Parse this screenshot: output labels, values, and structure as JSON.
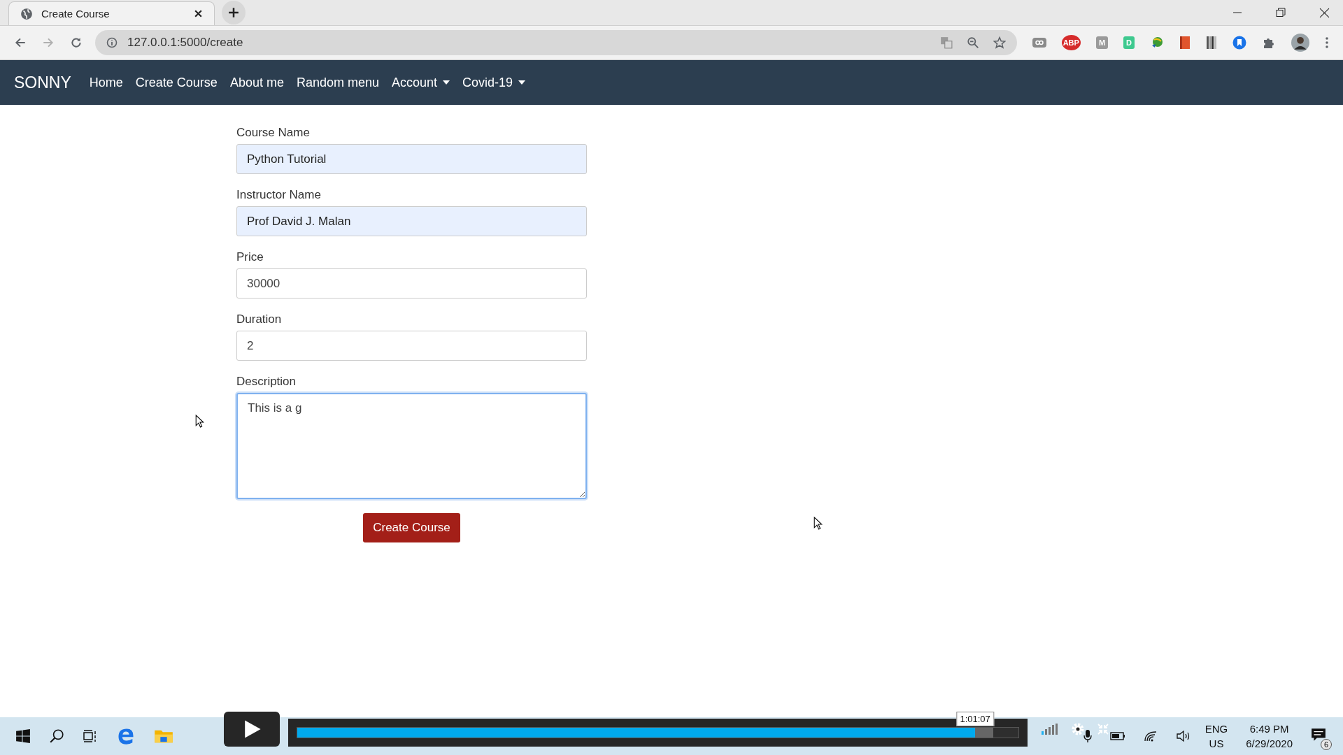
{
  "browser": {
    "tab": {
      "title": "Create Course",
      "selected": true
    },
    "url": "127.0.0.1:5000/create",
    "extensions": [
      {
        "kind": "pill"
      },
      {
        "kind": "badge",
        "text": "ABP",
        "color": "#d62b2b"
      },
      {
        "kind": "badge",
        "text": "M",
        "color": "#9a9a9a"
      },
      {
        "kind": "badge",
        "text": "D",
        "color": "#3ec98f"
      },
      {
        "kind": "globe"
      },
      {
        "kind": "book"
      },
      {
        "kind": "bars"
      },
      {
        "kind": "bookmark"
      },
      {
        "kind": "puzzle"
      },
      {
        "kind": "avatar"
      }
    ]
  },
  "navbar": {
    "brand": "SONNY",
    "items": [
      {
        "label": "Home",
        "kind": "link"
      },
      {
        "label": "Create Course",
        "kind": "link"
      },
      {
        "label": "About me",
        "kind": "link"
      },
      {
        "label": "Random menu",
        "kind": "link"
      },
      {
        "label": "Account",
        "kind": "dropdown"
      },
      {
        "label": "Covid-19",
        "kind": "dropdown"
      }
    ]
  },
  "form": {
    "fields": [
      {
        "label": "Course Name",
        "value": "Python Tutorial",
        "kind": "input",
        "autofilled": true,
        "focused": false
      },
      {
        "label": "Instructor Name",
        "value": "Prof David J. Malan",
        "kind": "input",
        "autofilled": true,
        "focused": false
      },
      {
        "label": "Price",
        "value": "30000",
        "kind": "input",
        "autofilled": false,
        "focused": false
      },
      {
        "label": "Duration",
        "value": "2",
        "kind": "input",
        "autofilled": false,
        "focused": false
      },
      {
        "label": "Description",
        "value": "This is a g",
        "kind": "textarea",
        "autofilled": false,
        "focused": true
      }
    ],
    "submit": "Create Course"
  },
  "video_player": {
    "time": "1:01:07",
    "level": 0.94
  },
  "taskbar": {
    "language": "ENG",
    "region": "US",
    "time": "6:49 PM",
    "date": "6/29/2020",
    "notifications": "6"
  }
}
